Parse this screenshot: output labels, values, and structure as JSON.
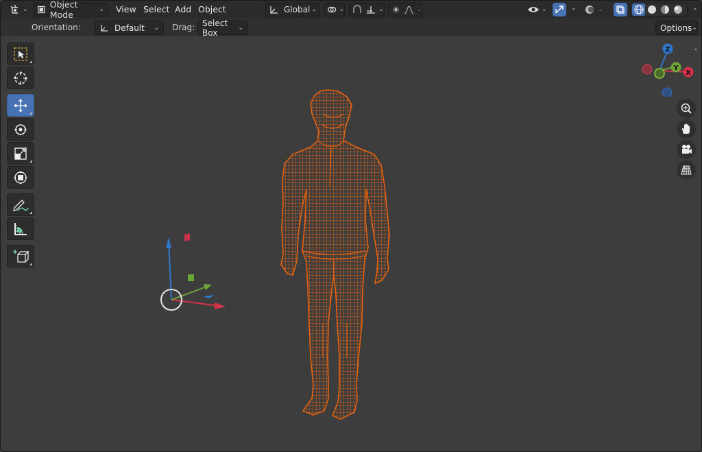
{
  "header": {
    "mode_label": "Object Mode",
    "menus": [
      "View",
      "Select",
      "Add",
      "Object"
    ],
    "orientation_label": "Global"
  },
  "toolsettings": {
    "orientation_label": "Orientation:",
    "orientation_value": "Default",
    "drag_label": "Drag:",
    "drag_value": "Select Box",
    "options_label": "Options"
  },
  "gizmo": {
    "z_label": "Z",
    "y_label": "Y",
    "x_label": "X"
  },
  "tools": [
    "select-box",
    "cursor",
    "move",
    "rotate",
    "scale",
    "transform",
    "annotate",
    "measure",
    "add-cube"
  ],
  "active_tool": "move",
  "colors": {
    "wire": "#e8620f",
    "accent": "#4772b3",
    "axis_x": "#d5324a",
    "axis_y": "#71a33a",
    "axis_z": "#2f78cc"
  }
}
